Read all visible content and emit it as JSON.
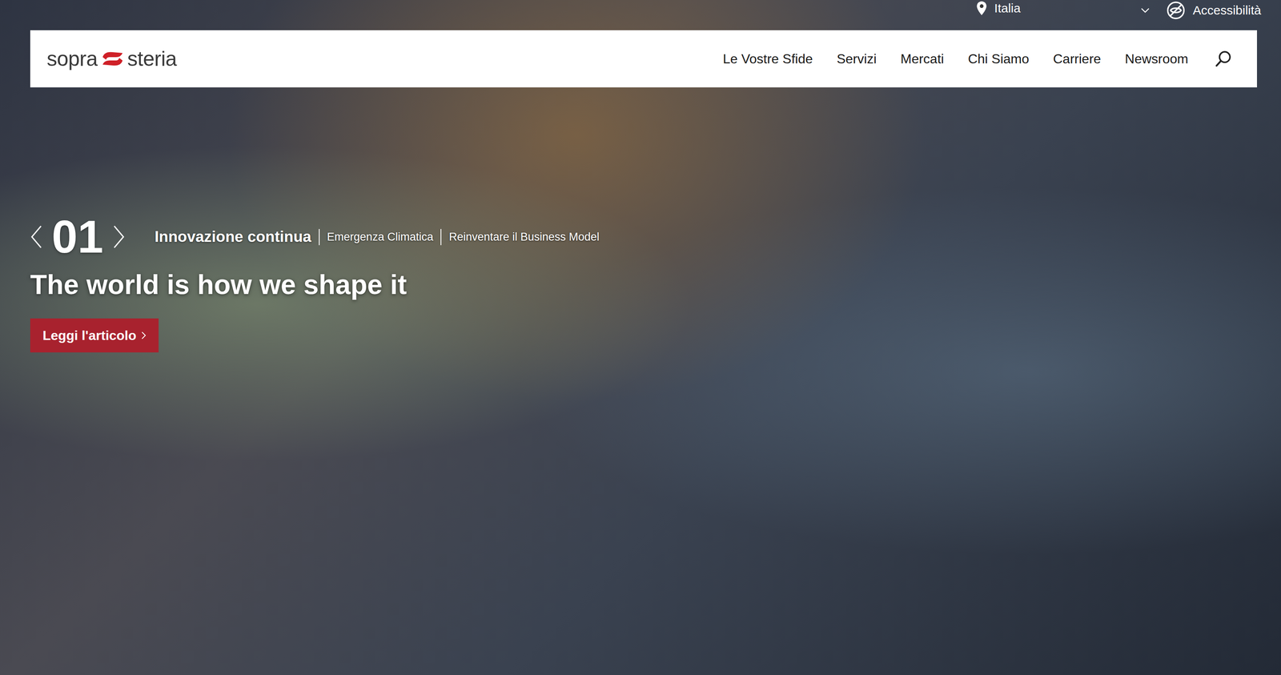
{
  "top_bar": {
    "location": "Italia",
    "accessibility": "Accessibilità"
  },
  "logo": {
    "left": "sopra",
    "right": "steria"
  },
  "nav": {
    "items": [
      {
        "label": "Le Vostre Sfide"
      },
      {
        "label": "Servizi"
      },
      {
        "label": "Mercati"
      },
      {
        "label": "Chi Siamo"
      },
      {
        "label": "Carriere"
      },
      {
        "label": "Newsroom"
      }
    ]
  },
  "hero": {
    "number": "01",
    "tabs": [
      {
        "label": "Innovazione continua",
        "selected": true
      },
      {
        "label": "Emergenza Climatica",
        "selected": false
      },
      {
        "label": "Reinventare il Business Model",
        "selected": false
      }
    ],
    "headline": "The world is how we shape it",
    "button": "Leggi l'articolo"
  }
}
